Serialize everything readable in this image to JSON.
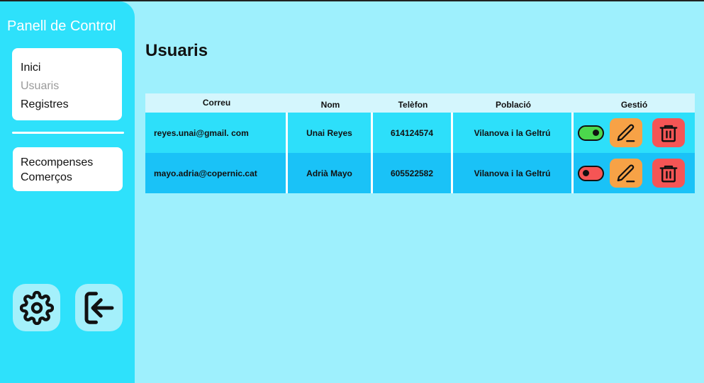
{
  "sidebar": {
    "title": "Panell de Control",
    "nav_main": [
      "Inici",
      "Usuaris",
      "Registres"
    ],
    "nav_secondary": [
      "Recompenses",
      "Comerços"
    ],
    "settings_icon": "gear-icon",
    "logout_icon": "logout-icon"
  },
  "main": {
    "title": "Usuaris"
  },
  "table": {
    "headers": [
      "Correu",
      "Nom",
      "Telèfon",
      "Població",
      "Gestió"
    ],
    "rows": [
      {
        "email": "reyes.unai@gmail. com",
        "name": "Unai Reyes",
        "phone": "614124574",
        "city": "Vilanova i la Geltrú",
        "active": true
      },
      {
        "email": "mayo.adria@copernic.cat",
        "name": "Adrià Mayo",
        "phone": "605522582",
        "city": "Vilanova i la Geltrú",
        "active": false
      }
    ]
  },
  "colors": {
    "toggle_on": "#4cd84c",
    "toggle_off": "#f55555",
    "edit": "#f7a246",
    "delete": "#f55555"
  }
}
